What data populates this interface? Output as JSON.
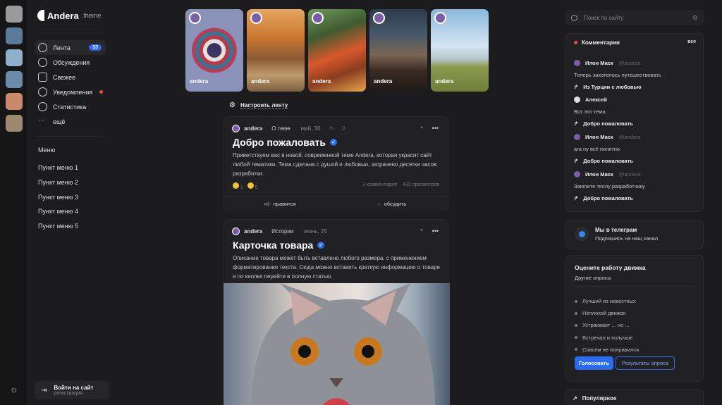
{
  "brand": {
    "name": "Andera",
    "suffix": ".theme"
  },
  "nav": [
    {
      "label": "Лента",
      "icon": "compass-icon",
      "badge": "33",
      "active": true
    },
    {
      "label": "Обсуждения",
      "icon": "chat-icon"
    },
    {
      "label": "Свежее",
      "icon": "calendar-icon"
    },
    {
      "label": "Уведомления",
      "icon": "bell-icon",
      "dot": true
    },
    {
      "label": "Статистика",
      "icon": "chart-icon"
    },
    {
      "label": "ещё",
      "icon": "more-icon"
    }
  ],
  "menu": {
    "title": "Меню",
    "items": [
      "Пункт меню 1",
      "Пункт меню 2",
      "Пункт меню 3",
      "Пункт меню 4",
      "Пункт меню 5"
    ]
  },
  "login": {
    "title": "Войти на сайт",
    "subtitle": "регистрация"
  },
  "stories": [
    {
      "author": "andera"
    },
    {
      "author": "andera"
    },
    {
      "author": "andera"
    },
    {
      "author": "andera"
    },
    {
      "author": "andera"
    }
  ],
  "feed": {
    "tune_label": "Настроить ленту"
  },
  "posts": [
    {
      "author": "andera",
      "category": "О теме",
      "date": "май, 30",
      "title": "Добро пожаловать",
      "text": "Приветствуем вас в новой, современной теме Andera, которая украсит сайт любой тематики. Тема сделана с душой и любовью, затрачено десятки часов разработки.",
      "reactions": [
        "1",
        "5"
      ],
      "comments": "3 комментария",
      "views": "432 просмотров",
      "like_label": "нравится",
      "discuss_label": "обсудить"
    },
    {
      "author": "andera",
      "category": "Истории",
      "date": "июнь, 25",
      "title": "Карточка товара",
      "text": "Описание товара может быть вставлено любого размера, с применением форматирования текста. Сюда можно вставить краткую информацию о товаре и по кнопке перейти в полную статью."
    }
  ],
  "search": {
    "placeholder": "Поиск по сайту"
  },
  "comments": {
    "title": "Комментарии",
    "all_label": "все",
    "items": [
      {
        "user": "Илон Маск",
        "handle": "@andera",
        "text": "Теперь захотелось путешествовать",
        "link": "Из Турции с любовью"
      },
      {
        "user": "Алексей",
        "handle": "",
        "text": "Вот это тема",
        "link": "Добро пожаловать"
      },
      {
        "user": "Илон Маск",
        "handle": "@andera",
        "text": "ага ну всё понятно",
        "link": "Добро пожаловать"
      },
      {
        "user": "Илон Маск",
        "handle": "@andera",
        "text": "Заюлите теслу разработчику",
        "link": "Добро пожаловать"
      }
    ]
  },
  "telegram": {
    "title": "Мы в телеграм",
    "subtitle": "Подпишись на наш канал"
  },
  "poll": {
    "title": "Оцените работу движка",
    "subtitle": "Другие опросы",
    "options": [
      "Лучший из новостных",
      "Неплохой движок",
      "Устраивает ... но ...",
      "Встречал и получше",
      "Совсем не понравился"
    ],
    "vote_label": "Голосовать",
    "results_label": "Результаты опроса"
  },
  "popular": {
    "title": "Популярное"
  },
  "colors": {
    "accent": "#2a6bf2",
    "notify": "#e74c3c",
    "background": "#1c1c1e"
  }
}
